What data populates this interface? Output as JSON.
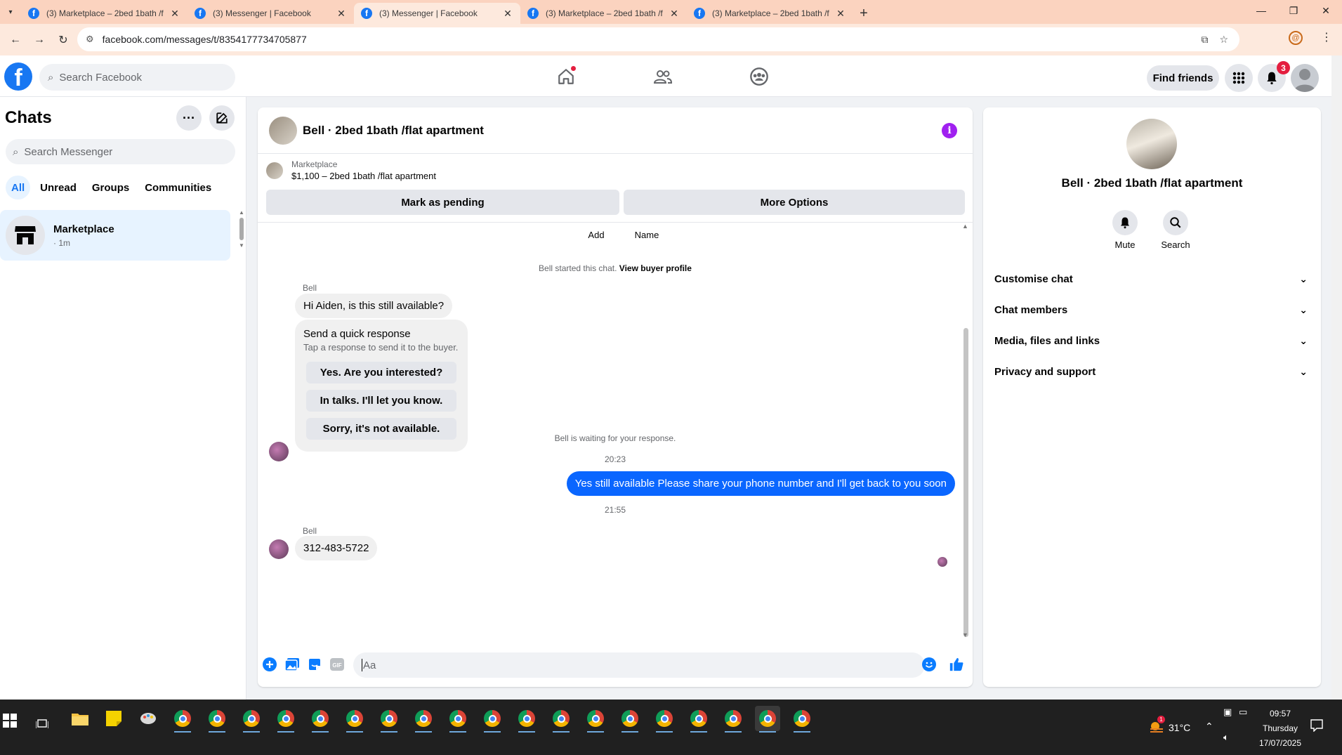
{
  "browser": {
    "tabs": [
      {
        "title": "(3) Marketplace – 2bed 1bath /f",
        "active": false
      },
      {
        "title": "(3) Messenger | Facebook",
        "active": false
      },
      {
        "title": "(3) Messenger | Facebook",
        "active": true
      },
      {
        "title": "(3) Marketplace – 2bed 1bath /f",
        "active": false
      },
      {
        "title": "(3) Marketplace – 2bed 1bath /f",
        "active": false
      }
    ],
    "url": "facebook.com/messages/t/8354177734705877"
  },
  "fb_header": {
    "search_placeholder": "Search Facebook",
    "find_friends": "Find friends",
    "notification_count": "3"
  },
  "sidebar": {
    "title": "Chats",
    "search_placeholder": "Search Messenger",
    "filters": [
      "All",
      "Unread",
      "Groups",
      "Communities"
    ],
    "active_filter": "All",
    "chats": [
      {
        "name": "Marketplace",
        "time": "· 1m"
      }
    ]
  },
  "conversation": {
    "title": "Bell · 2bed 1bath /flat apartment",
    "marketplace_label": "Marketplace",
    "listing": "$1,100 – 2bed 1bath /flat apartment",
    "mark_pending": "Mark as pending",
    "more_options": "More Options",
    "top_actions": [
      "Add",
      "Name"
    ],
    "started_text": "Bell started this chat.",
    "view_profile": "View buyer profile",
    "sender1": "Bell",
    "msg1": "Hi Aiden, is this still available?",
    "quick_title": "Send a quick response",
    "quick_sub": "Tap a response to send it to the buyer.",
    "quick_responses": [
      "Yes. Are you interested?",
      "In talks. I'll let you know.",
      "Sorry, it's not available."
    ],
    "waiting": "Bell is waiting for your response.",
    "time1": "20:23",
    "msg_out": "Yes still available Please share your phone number and I'll get back to you soon",
    "time2": "21:55",
    "sender2": "Bell",
    "msg2": "312-483-5722",
    "composer_placeholder": "Aa"
  },
  "details": {
    "title": "Bell · 2bed 1bath /flat apartment",
    "buttons": [
      "Mute",
      "Search"
    ],
    "sections": [
      "Customise chat",
      "Chat members",
      "Media, files and links",
      "Privacy and support"
    ]
  },
  "taskbar": {
    "temperature": "31°C",
    "weather_badge": "1",
    "time": "09:57",
    "day": "Thursday",
    "date": "17/07/2025"
  }
}
